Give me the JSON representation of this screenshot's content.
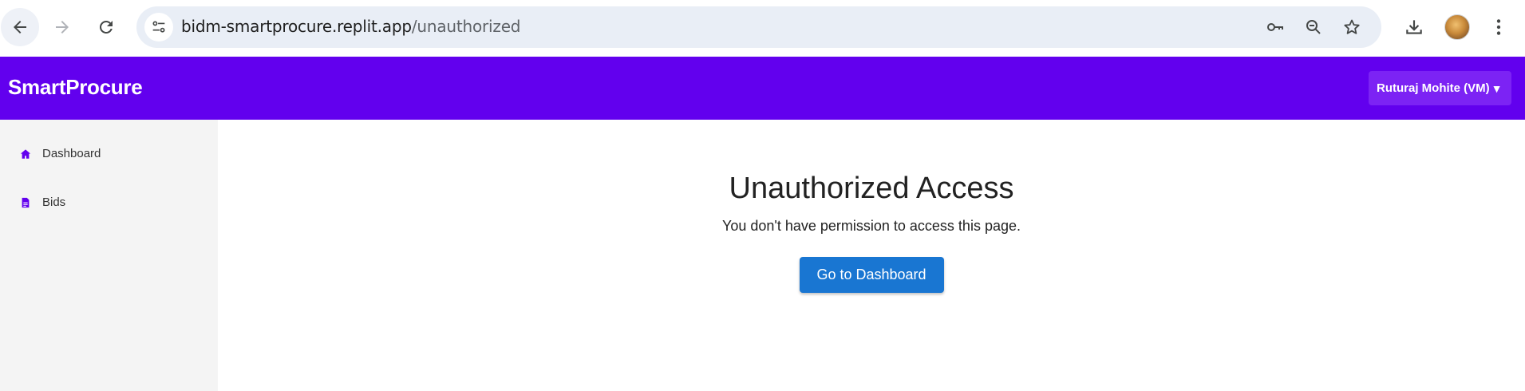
{
  "browser": {
    "url_domain": "bidm-smartprocure.replit.app",
    "url_path": "/unauthorized",
    "icons": {
      "back": "back-arrow-icon",
      "forward": "forward-arrow-icon",
      "reload": "reload-icon",
      "site_info": "site-settings-icon",
      "password": "key-icon",
      "zoom": "zoom-out-icon",
      "bookmark": "star-icon",
      "download": "download-icon",
      "profile": "avatar",
      "menu": "kebab-menu-icon"
    }
  },
  "header": {
    "brand": "SmartProcure",
    "user_label": "Ruturaj Mohite (VM)",
    "user_caret": "▼",
    "background_color": "#6200ee"
  },
  "sidebar": {
    "items": [
      {
        "label": "Dashboard",
        "icon": "home-icon"
      },
      {
        "label": "Bids",
        "icon": "document-icon"
      }
    ],
    "icon_color": "#6200ee"
  },
  "main": {
    "title": "Unauthorized Access",
    "message": "You don't have permission to access this page.",
    "button_label": "Go to Dashboard",
    "button_color": "#1976d2"
  }
}
